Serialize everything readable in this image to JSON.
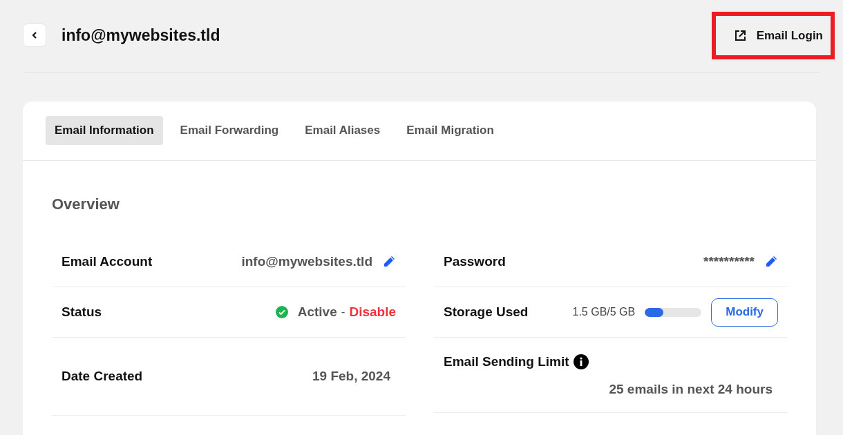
{
  "header": {
    "title": "info@mywebsites.tld",
    "login_button": {
      "label": "Email Login",
      "highlighted": true
    }
  },
  "tabs": [
    {
      "label": "Email Information",
      "selected": true
    },
    {
      "label": "Email Forwarding",
      "selected": false
    },
    {
      "label": "Email Aliases",
      "selected": false
    },
    {
      "label": "Email Migration",
      "selected": false
    }
  ],
  "overview": {
    "title": "Overview",
    "left": [
      {
        "kind": "editable",
        "label": "Email Account",
        "value": "info@mywebsites.tld"
      },
      {
        "kind": "status",
        "label": "Status",
        "value": "Active",
        "separator": "-",
        "action": "Disable",
        "active": true
      },
      {
        "kind": "plain",
        "label": "Date Created",
        "value": "19 Feb, 2024"
      }
    ],
    "right": [
      {
        "kind": "editable",
        "label": "Password",
        "value": "**********"
      },
      {
        "kind": "storage",
        "label": "Storage Used",
        "value": "1.5 GB/5 GB",
        "level": 0.33,
        "button": "Modify"
      },
      {
        "kind": "limit",
        "label": "Email Sending Limit",
        "value": "25 emails in next 24 hours"
      }
    ]
  }
}
